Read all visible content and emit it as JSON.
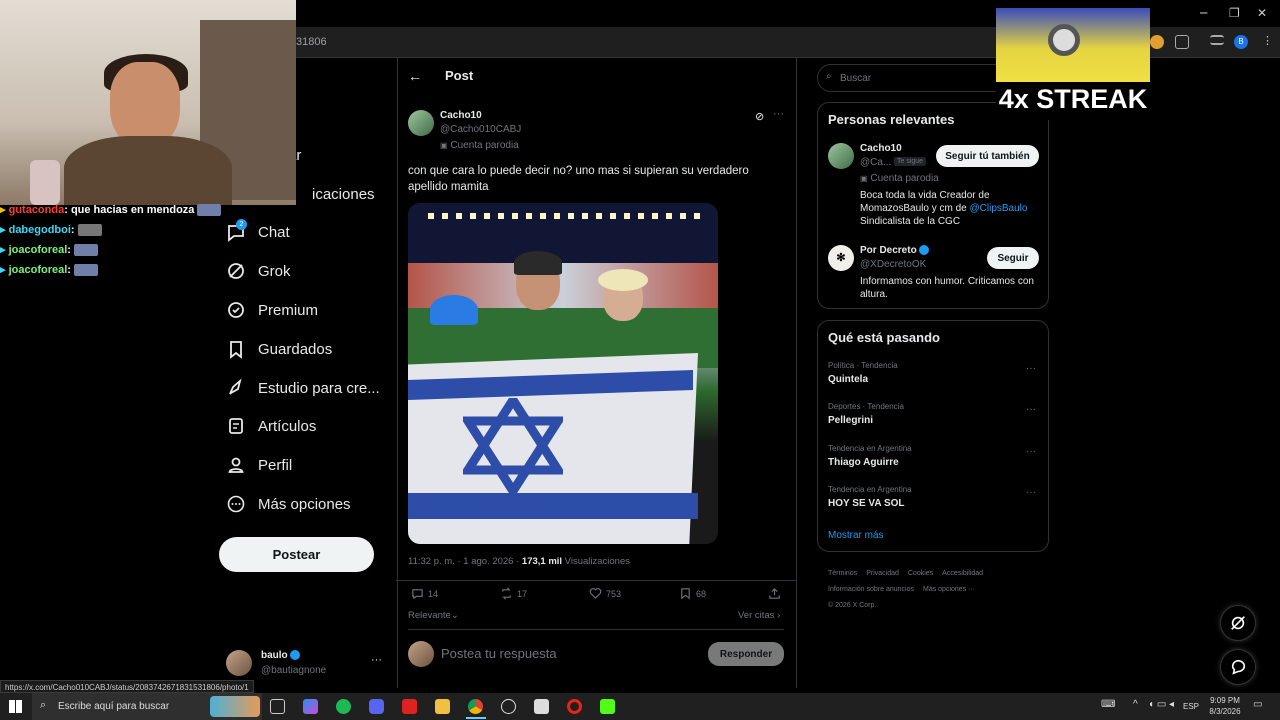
{
  "browser": {
    "url_fragment": "31806",
    "profile_initial": "B",
    "status_url": "https://x.com/Cacho010CABJ/status/2083742671831531806/photo/1"
  },
  "overlay": {
    "streak_text": "4x STREAK",
    "chat": [
      {
        "user": "gutaconda",
        "message": ": que hacias en mendoza",
        "color": "#ff3b30"
      },
      {
        "user": "dabegodboi",
        "message": ":",
        "color": "#38d9f5"
      },
      {
        "user": "joacoforeal",
        "message": ":",
        "color": "#7cf27c"
      },
      {
        "user": "joacoforeal",
        "message": ":",
        "color": "#7cf27c"
      }
    ]
  },
  "sidebar": {
    "items": [
      {
        "label": "ar",
        "icon": "search-icon"
      },
      {
        "label": "icaciones",
        "icon": "bell-icon"
      },
      {
        "label": "Chat",
        "icon": "chat-icon",
        "badge": "2"
      },
      {
        "label": "Grok",
        "icon": "grok-icon"
      },
      {
        "label": "Premium",
        "icon": "premium-icon"
      },
      {
        "label": "Guardados",
        "icon": "bookmark-icon"
      },
      {
        "label": "Estudio para cre...",
        "icon": "rocket-icon"
      },
      {
        "label": "Artículos",
        "icon": "article-icon"
      },
      {
        "label": "Perfil",
        "icon": "person-icon"
      },
      {
        "label": "Más opciones",
        "icon": "more-circle-icon"
      }
    ],
    "post_button": "Postear",
    "account": {
      "name": "baulo",
      "handle": "@bautiagnone"
    }
  },
  "post": {
    "header": "Post",
    "author_name": "Cacho10",
    "author_handle": "@Cacho010CABJ",
    "parody_label": "Cuenta parodia",
    "text": "con que cara lo puede decir no? uno mas si supieran su verdadero apellido mamita",
    "time": "11:32 p. m. · 1 ago. 2026 · ",
    "views_count": "173,1 mil",
    "views_label": " Visualizaciones",
    "replies": "14",
    "reposts": "17",
    "likes": "753",
    "bookmarks": "68",
    "sort_label": "Relevante",
    "quotes_label": "Ver citas",
    "reply_placeholder": "Postea tu respuesta",
    "reply_button": "Responder"
  },
  "right": {
    "search_placeholder": "Buscar",
    "relevant_title": "Personas relevantes",
    "people": [
      {
        "name": "Cacho10",
        "handle": "@Ca...",
        "follows_you": "Te sigue",
        "parody": "Cuenta parodia",
        "bio_prefix": "Boca toda la vida Creador de MomazosBaulo y cm de ",
        "bio_link": "@ClipsBaulo",
        "bio_suffix": " Sindicalista de la CGC",
        "button": "Seguir tú también"
      },
      {
        "name": "Por Decreto",
        "handle": "@XDecretoOK",
        "bio": "Informamos con humor. Criticamos con altura.",
        "button": "Seguir"
      }
    ],
    "trends_title": "Qué está pasando",
    "trends": [
      {
        "category": "Política · Tendencia",
        "name": "Quintela"
      },
      {
        "category": "Deportes · Tendencia",
        "name": "Pellegrini"
      },
      {
        "category": "Tendencia en Argentina",
        "name": "Thiago Aguirre"
      },
      {
        "category": "Tendencia en Argentina",
        "name": "HOY SE VA SOL"
      }
    ],
    "show_more": "Mostrar más",
    "footer": [
      "Términos",
      "Privacidad",
      "Cookies",
      "Accesibilidad",
      "Información sobre anuncios",
      "Más opciones ···",
      "© 2026 X Corp."
    ]
  },
  "taskbar": {
    "search_placeholder": "Escribe aquí para buscar",
    "lang": "ESP",
    "time": "9:09 PM",
    "date": "8/3/2026"
  },
  "colors": {
    "accent": "#1d9bf0",
    "verified": "#1d9bf0"
  }
}
